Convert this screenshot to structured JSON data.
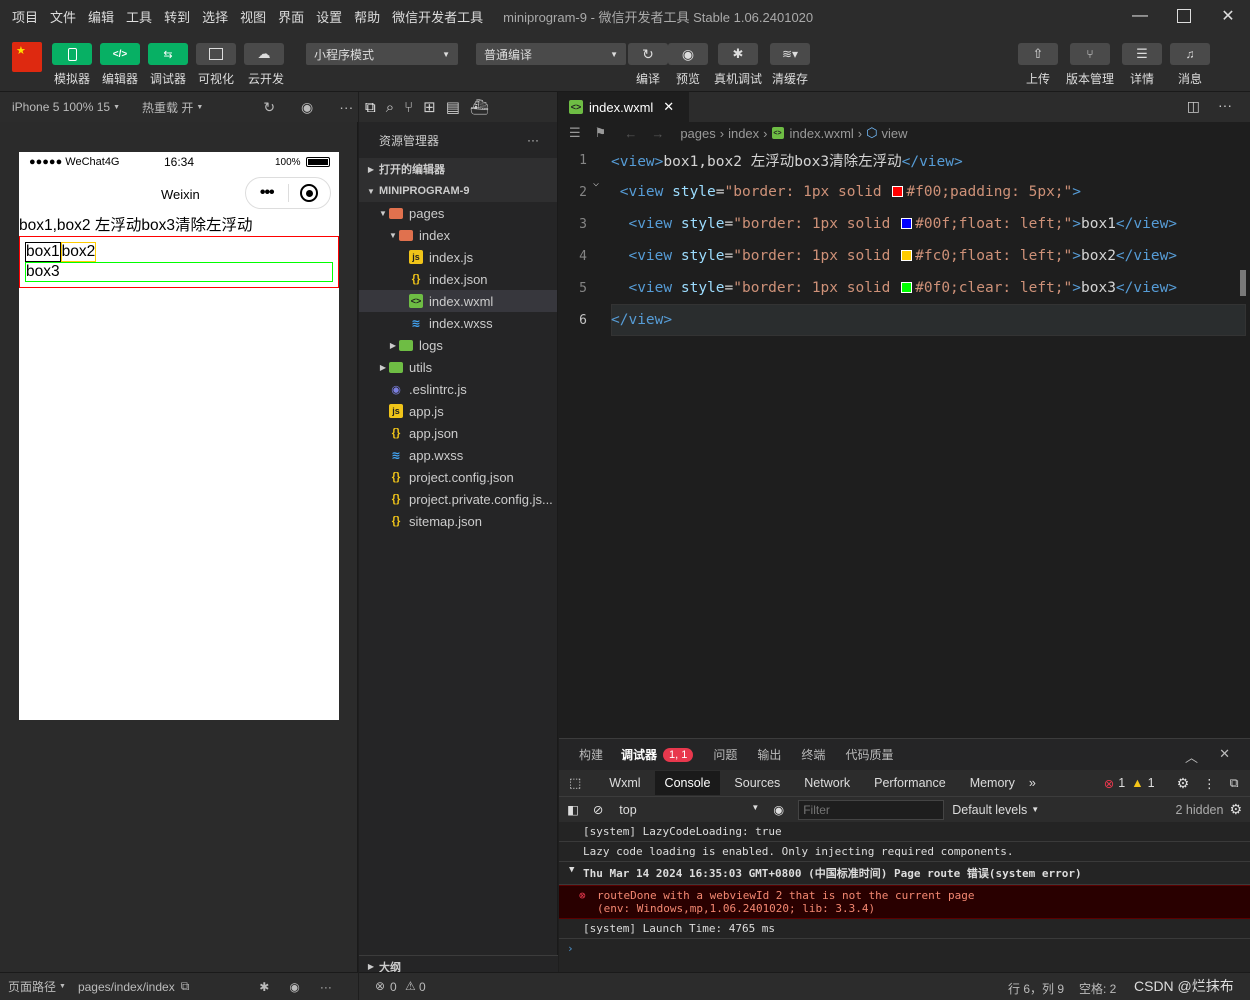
{
  "menubar": {
    "items": [
      "项目",
      "文件",
      "编辑",
      "工具",
      "转到",
      "选择",
      "视图",
      "界面",
      "设置",
      "帮助",
      "微信开发者工具"
    ],
    "title": "miniprogram-9 - 微信开发者工具 Stable 1.06.2401020"
  },
  "toolbar": {
    "left_buttons": [
      "模拟器",
      "编辑器",
      "调试器",
      "可视化",
      "云开发"
    ],
    "mode_select": "小程序模式",
    "compile_select": "普通编译",
    "mid_buttons": [
      "编译",
      "预览",
      "真机调试",
      "清缓存"
    ],
    "right_buttons": [
      "上传",
      "版本管理",
      "详情",
      "消息"
    ]
  },
  "simulator": {
    "device": "iPhone 5 100% 15",
    "hot_reload": "热重载 开",
    "status_carrier": "●●●●● WeChat4G",
    "status_time": "16:34",
    "status_battery": "100%",
    "nav_title": "Weixin",
    "content_heading": "box1,box2 左浮动box3清除左浮动",
    "box1": "box1",
    "box2": "box2",
    "box3": "box3",
    "footer_path_label": "页面路径",
    "footer_path": "pages/index/index"
  },
  "explorer": {
    "title": "资源管理器",
    "open_editors": "打开的编辑器",
    "project": "MINIPROGRAM-9",
    "outline": "大纲",
    "tree": [
      {
        "name": "pages",
        "depth": 1,
        "type": "folder-open"
      },
      {
        "name": "index",
        "depth": 2,
        "type": "folder-open"
      },
      {
        "name": "index.js",
        "depth": 3,
        "type": "js"
      },
      {
        "name": "index.json",
        "depth": 3,
        "type": "json"
      },
      {
        "name": "index.wxml",
        "depth": 3,
        "type": "wxml",
        "selected": true
      },
      {
        "name": "index.wxss",
        "depth": 3,
        "type": "wxss"
      },
      {
        "name": "logs",
        "depth": 2,
        "type": "folder"
      },
      {
        "name": "utils",
        "depth": 1,
        "type": "folder"
      },
      {
        "name": ".eslintrc.js",
        "depth": 1,
        "type": "eslint"
      },
      {
        "name": "app.js",
        "depth": 1,
        "type": "js"
      },
      {
        "name": "app.json",
        "depth": 1,
        "type": "json"
      },
      {
        "name": "app.wxss",
        "depth": 1,
        "type": "wxss"
      },
      {
        "name": "project.config.json",
        "depth": 1,
        "type": "json"
      },
      {
        "name": "project.private.config.js...",
        "depth": 1,
        "type": "json"
      },
      {
        "name": "sitemap.json",
        "depth": 1,
        "type": "json"
      }
    ]
  },
  "editor": {
    "tab": "index.wxml",
    "breadcrumbs": [
      "pages",
      "index",
      "index.wxml",
      "view"
    ],
    "lines": [
      {
        "n": "1",
        "parts": [
          [
            "tg",
            "<view>"
          ],
          [
            "tx",
            "box1,box2 左浮动box3清除左浮动"
          ],
          [
            "tg",
            "</view>"
          ]
        ]
      },
      {
        "n": "2",
        "parts": [
          [
            "tx",
            " "
          ],
          [
            "tg",
            "<view"
          ],
          [
            "at",
            " style"
          ],
          [
            "tx",
            "="
          ],
          [
            "vl",
            "\"border: 1px solid "
          ],
          [
            "sw",
            "#f00"
          ],
          [
            "vl",
            "#f00;padding: 5px;\""
          ],
          [
            "tg",
            ">"
          ]
        ]
      },
      {
        "n": "3",
        "parts": [
          [
            "tx",
            "  "
          ],
          [
            "tg",
            "<view"
          ],
          [
            "at",
            " style"
          ],
          [
            "tx",
            "="
          ],
          [
            "vl",
            "\"border: 1px solid "
          ],
          [
            "sw",
            "#00f"
          ],
          [
            "vl",
            "#00f;float: left;\""
          ],
          [
            "tg",
            ">"
          ],
          [
            "tx",
            "box1"
          ],
          [
            "tg",
            "</view>"
          ]
        ]
      },
      {
        "n": "4",
        "parts": [
          [
            "tx",
            "  "
          ],
          [
            "tg",
            "<view"
          ],
          [
            "at",
            " style"
          ],
          [
            "tx",
            "="
          ],
          [
            "vl",
            "\"border: 1px solid "
          ],
          [
            "sw",
            "#fc0"
          ],
          [
            "vl",
            "#fc0;float: left;\""
          ],
          [
            "tg",
            ">"
          ],
          [
            "tx",
            "box2"
          ],
          [
            "tg",
            "</view>"
          ]
        ]
      },
      {
        "n": "5",
        "parts": [
          [
            "tx",
            "  "
          ],
          [
            "tg",
            "<view"
          ],
          [
            "at",
            " style"
          ],
          [
            "tx",
            "="
          ],
          [
            "vl",
            "\"border: 1px solid "
          ],
          [
            "sw",
            "#0f0"
          ],
          [
            "vl",
            "#0f0;clear: left;\""
          ],
          [
            "tg",
            ">"
          ],
          [
            "tx",
            "box3"
          ],
          [
            "tg",
            "</view>"
          ]
        ]
      },
      {
        "n": "6",
        "parts": [
          [
            "tg",
            "</view>"
          ]
        ]
      }
    ]
  },
  "debugger": {
    "top_tabs": [
      "构建",
      "调试器",
      "问题",
      "输出",
      "终端",
      "代码质量"
    ],
    "badge": "1, 1",
    "devtools_tabs": [
      "Wxml",
      "Console",
      "Sources",
      "Network",
      "Performance",
      "Memory"
    ],
    "err_count": "1",
    "warn_count": "1",
    "context": "top",
    "filter_placeholder": "Filter",
    "levels": "Default levels",
    "hidden": "2 hidden",
    "logs": {
      "l1": "[system] LazyCodeLoading: true",
      "l2": "Lazy code loading is enabled. Only injecting required components.",
      "l3": "Thu Mar 14 2024 16:35:03 GMT+0800 (中国标准时间) Page route 错误(system error)",
      "l4a": "routeDone with a webviewId 2 that is not the current page",
      "l4b": "(env: Windows,mp,1.06.2401020; lib: 3.3.4)",
      "l5": "[system] Launch Time: 4765 ms"
    }
  },
  "status": {
    "errors": "0",
    "warnings": "0",
    "position": "行 6，列 9",
    "spaces": "空格: 2",
    "watermark": "CSDN @烂抹布"
  }
}
